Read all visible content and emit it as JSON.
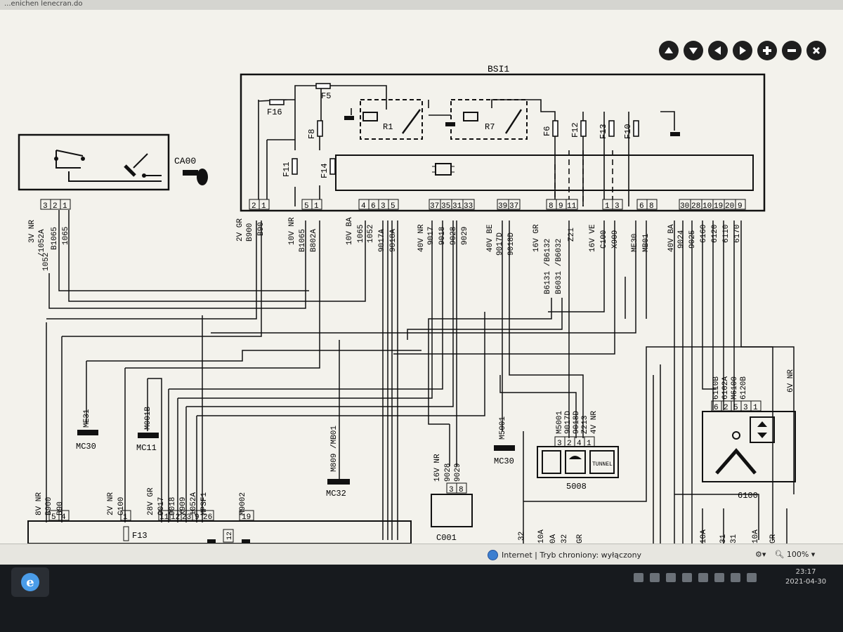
{
  "tab": {
    "title": "...enichen lenecran.do"
  },
  "nav_buttons": [
    {
      "name": "nav-up-button",
      "icon": "arrow-up-icon"
    },
    {
      "name": "nav-down-button",
      "icon": "arrow-down-icon"
    },
    {
      "name": "nav-left-button",
      "icon": "arrow-left-icon"
    },
    {
      "name": "nav-right-button",
      "icon": "arrow-right-icon"
    },
    {
      "name": "zoom-in-button",
      "icon": "plus-icon"
    },
    {
      "name": "zoom-out-button",
      "icon": "minus-icon"
    },
    {
      "name": "close-button",
      "icon": "close-icon"
    }
  ],
  "schematic": {
    "bsi": "BSI1",
    "ca00": "CA00",
    "fuses": {
      "f16": "F16",
      "f5": "F5",
      "f8": "F8",
      "f11": "F11",
      "f14": "F14",
      "f6": "F6",
      "f12": "F12",
      "f13": "F13",
      "f10": "F10",
      "r1": "R1",
      "r7": "R7"
    },
    "ca00_pins": [
      "3",
      "2",
      "1"
    ],
    "bsi_pin_groups": {
      "g1": [
        "2",
        "1"
      ],
      "g2": [
        "5",
        "1"
      ],
      "g3": [
        "4",
        "6",
        "3",
        "5"
      ],
      "g4": [
        "37",
        "35",
        "31",
        "33"
      ],
      "g5": [
        "39",
        "37"
      ],
      "g6": [
        "8",
        "9",
        "11"
      ],
      "g7": [
        "1",
        "3"
      ],
      "g8": [
        "6",
        "8"
      ],
      "g9": [
        "30",
        "28",
        "10",
        "19",
        "20",
        "9"
      ]
    },
    "wire_labels": {
      "ca00_a": "1052",
      "ca00_b": "3V NR",
      "ca00_c": "/1052A",
      "ca00_d": "B1065",
      "ca00_e": "1065",
      "g1_a": "2V GR",
      "g1_b": "B900",
      "g1_c": "B90",
      "g2_a": "10V NR",
      "g2_b": "B1065",
      "g2_c": "B802A",
      "g3_a": "10V BA",
      "g3_b": "1065",
      "g3_c": "1052",
      "g3_d": "9017A",
      "g3_e": "9018A",
      "g4_a": "40V NR",
      "g4_b": "9017",
      "g4_c": "9018",
      "g4_d": "9028",
      "g4_e": "9029",
      "g5_a": "40V BE",
      "g5_b": "9017D",
      "g5_c": "9018D",
      "g6_a": "16V GR",
      "g6_b": "B6131 /B6132",
      "g6_c": "B6031 /B6032",
      "g6_d": "Z21",
      "g7_a": "16V VE",
      "g7_b": "C100",
      "g7_c": "X909",
      "g8_a": "ME30",
      "g8_b": "MB01",
      "g9_a": "40V BA",
      "g9_b": "9024",
      "g9_c": "9025",
      "g9_d": "6160",
      "g9_e": "6120",
      "g9_f": "6110",
      "g9_g": "6170"
    },
    "grounds": {
      "me31": "ME31",
      "mc30a": "MC30",
      "m001b": "M001B",
      "mc11": "MC11",
      "m809": "M809 /MB01",
      "mc32": "MC32",
      "m5001": "M5001",
      "mc30b": "MC30"
    },
    "c001": {
      "name": "C001",
      "pins": [
        "3",
        "8"
      ],
      "wires": [
        "16V NR",
        "9028",
        "9029"
      ]
    },
    "module5008": {
      "name": "5008",
      "pins": [
        "3",
        "2",
        "4",
        "1"
      ],
      "wires": [
        "M5001",
        "9017D",
        "9018D",
        "Z213",
        "4V NR"
      ],
      "button": "TUNNEL"
    },
    "module6100": {
      "name": "6100",
      "pins": [
        "6",
        "2",
        "5",
        "3",
        "1"
      ],
      "wires": [
        "6110B",
        "6102A",
        "M6100",
        "6120B",
        "6V NR"
      ]
    },
    "bottom": {
      "conn_a_pins": [
        "5",
        "4"
      ],
      "conn_a_wires": [
        "8V NR",
        "B900",
        "B90"
      ],
      "conn_b_pin": "1",
      "conn_b_wires": [
        "2V NR",
        "C100"
      ],
      "f13": "F13",
      "conn_c_pins": [
        "11",
        "12",
        "23",
        "9",
        "26"
      ],
      "conn_c_wires": [
        "28V GR",
        "9017",
        "9018",
        "X909",
        "1052A",
        "MPSF1"
      ],
      "m9002": "M9002",
      "pin19": "19",
      "pin12": "12",
      "edge_labels": [
        "32",
        "10A",
        "0A",
        "32",
        "GR",
        "10A",
        "31",
        "31",
        "10A",
        "GR"
      ]
    }
  },
  "status_bar": {
    "zone_text": "Internet | Tryb chroniony: wyłączony",
    "zoom": "100%"
  },
  "taskbar": {
    "time": "23:17",
    "date": "2021-04-30"
  }
}
